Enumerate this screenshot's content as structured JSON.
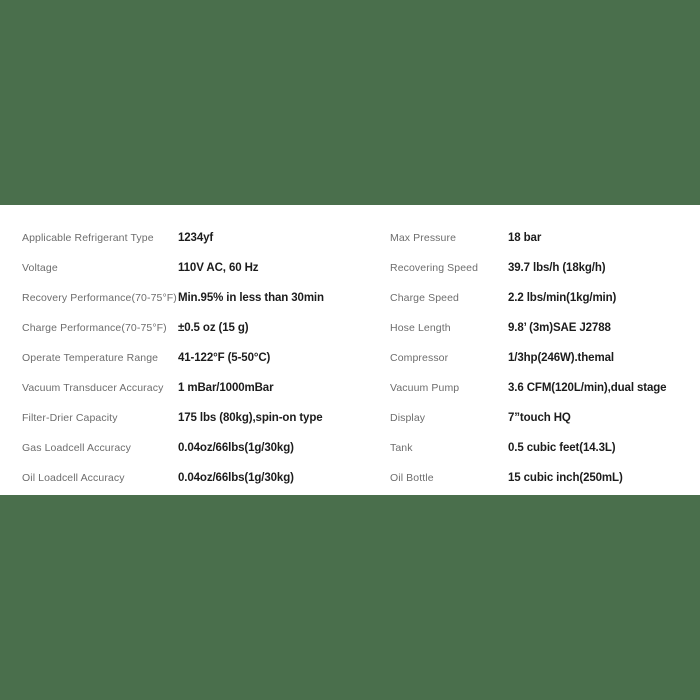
{
  "theme": {
    "background_color": "#4a6f4c",
    "panel_color": "#ffffff",
    "label_color": "#6d6d6d",
    "value_color": "#1c1c1c"
  },
  "spec_table": {
    "columns": [
      {
        "name": "left-column",
        "rows": [
          {
            "label": "Applicable Refrigerant Type",
            "value": "1234yf"
          },
          {
            "label": "Voltage",
            "value": "110V AC, 60 Hz"
          },
          {
            "label": "Recovery Performance(70-75°F)",
            "value": "Min.95% in less than 30min"
          },
          {
            "label": "Charge Performance(70-75°F)",
            "value": "±0.5 oz (15 g)"
          },
          {
            "label": "Operate Temperature Range",
            "value": "41-122°F (5-50°C)"
          },
          {
            "label": "Vacuum Transducer Accuracy",
            "value": "1 mBar/1000mBar"
          },
          {
            "label": "Filter-Drier Capacity",
            "value": "175 lbs (80kg),spin-on type"
          },
          {
            "label": "Gas Loadcell Accuracy",
            "value": "0.04oz/66lbs(1g/30kg)"
          },
          {
            "label": "Oil Loadcell Accuracy",
            "value": "0.04oz/66lbs(1g/30kg)"
          }
        ]
      },
      {
        "name": "right-column",
        "rows": [
          {
            "label": "Max Pressure",
            "value": "18 bar"
          },
          {
            "label": "Recovering Speed",
            "value": "39.7 lbs/h (18kg/h)"
          },
          {
            "label": "Charge Speed",
            "value": "2.2 lbs/min(1kg/min)"
          },
          {
            "label": "Hose Length",
            "value": "9.8’  (3m)SAE J2788"
          },
          {
            "label": "Compressor",
            "value": "1/3hp(246W).themal"
          },
          {
            "label": "Vacuum Pump",
            "value": "3.6 CFM(120L/min),dual stage"
          },
          {
            "label": "Display",
            "value": "7”touch HQ"
          },
          {
            "label": "Tank",
            "value": "0.5 cubic feet(14.3L)"
          },
          {
            "label": "Oil Bottle",
            "value": "15 cubic inch(250mL)"
          }
        ]
      }
    ]
  }
}
